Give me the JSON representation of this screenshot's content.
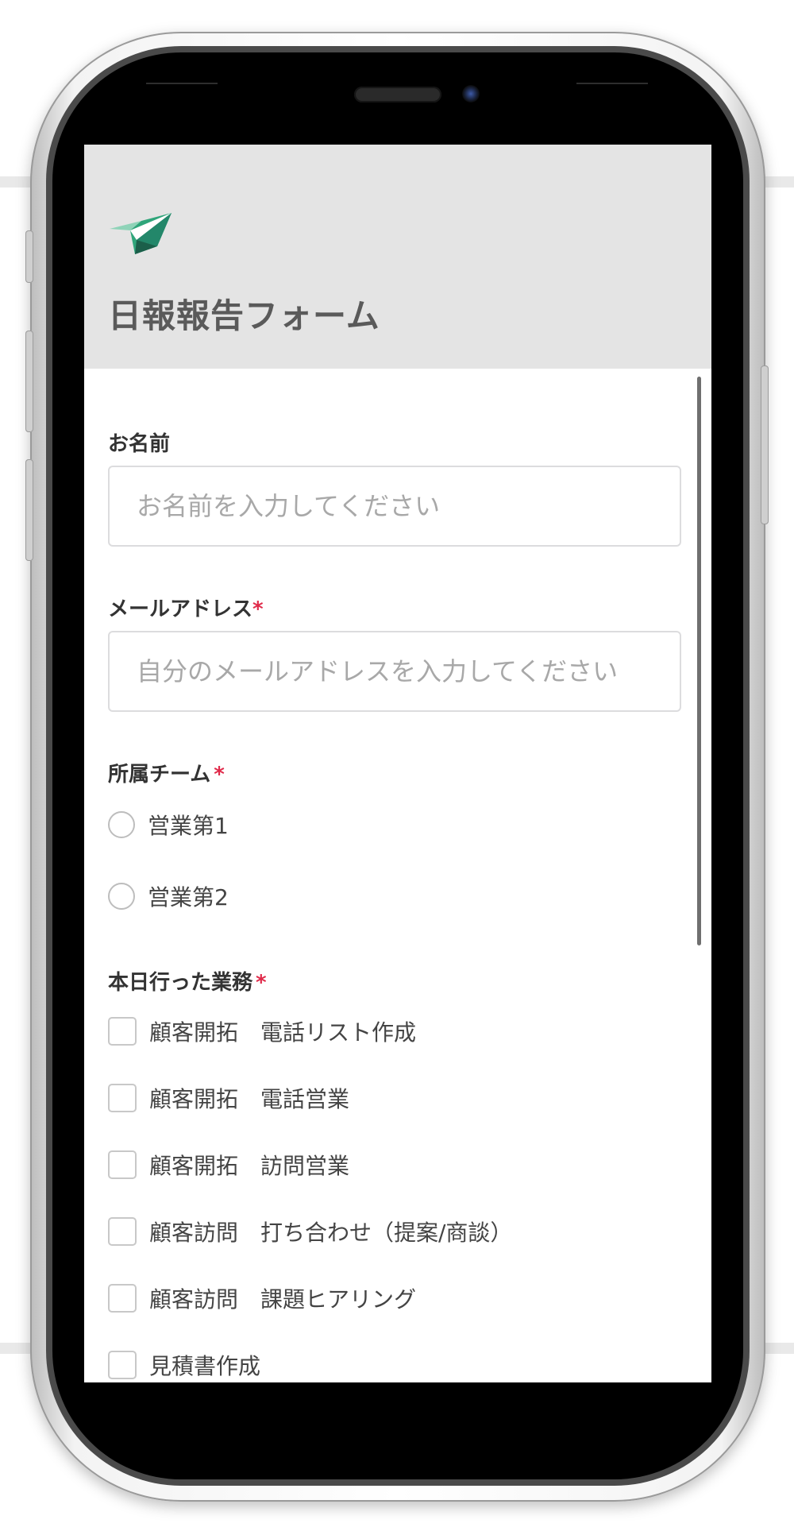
{
  "form": {
    "title": "日報報告フォーム",
    "logo_icon": "paper-plane-logo-icon",
    "required_mark": "*",
    "fields": {
      "name": {
        "label": "お名前",
        "placeholder": "お名前を入力してください",
        "required": false
      },
      "email": {
        "label": "メールアドレス",
        "placeholder": "自分のメールアドレスを入力してください",
        "required": true
      },
      "team": {
        "label": "所属チーム",
        "required": true,
        "options": [
          "営業第1",
          "営業第2"
        ]
      },
      "tasks": {
        "label": "本日行った業務",
        "required": true,
        "options": [
          "顧客開拓　電話リスト作成",
          "顧客開拓　電話営業",
          "顧客開拓　訪問営業",
          "顧客訪問　打ち合わせ（提案/商談）",
          "顧客訪問　課題ヒアリング",
          "見積書作成"
        ]
      }
    }
  },
  "colors": {
    "header_bg": "#e4e4e4",
    "required_mark": "#e02a4a",
    "logo_green": "#2fa57a",
    "logo_dark": "#1b5f4a"
  }
}
